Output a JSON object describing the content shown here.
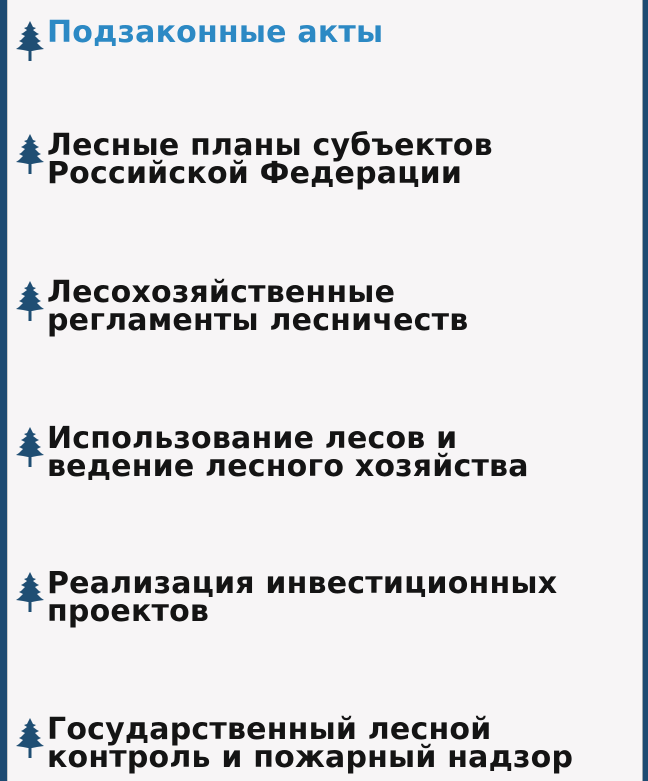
{
  "menu": {
    "items": [
      {
        "lines": [
          "Подзаконные акты"
        ],
        "active": true
      },
      {
        "lines": [
          "Лесные планы субъектов",
          "Российской Федерации"
        ],
        "active": false
      },
      {
        "lines": [
          "Лесохозяйственные",
          "регламенты лесничеств"
        ],
        "active": false
      },
      {
        "lines": [
          "Использование лесов и",
          "ведение лесного хозяйства"
        ],
        "active": false
      },
      {
        "lines": [
          "Реализация инвестиционных",
          "проектов"
        ],
        "active": false
      },
      {
        "lines": [
          "Государственный лесной",
          "контроль и пожарный надзор"
        ],
        "active": false
      }
    ]
  },
  "icons": {
    "bullet": "fir-tree-icon"
  },
  "colors": {
    "sidebar_bg": "#1d4a72",
    "panel_bg": "#f7f5f6",
    "active_text": "#2c89c4",
    "text": "#141414",
    "icon": "#1f4e73"
  }
}
